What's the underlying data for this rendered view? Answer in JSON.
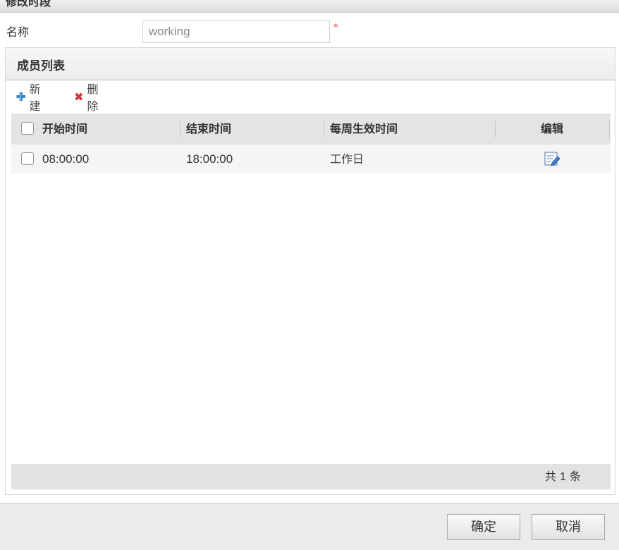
{
  "dialog": {
    "title": "修改时段"
  },
  "form": {
    "name_label": "名称",
    "name_value": "working",
    "required_mark": "*"
  },
  "panel": {
    "title": "成员列表",
    "toolbar": {
      "new_label": "新建",
      "new_icon": "plus-icon",
      "delete_label": "删除",
      "delete_icon": "delete-x-icon"
    },
    "grid": {
      "columns": [
        "开始时间",
        "结束时间",
        "每周生效时间",
        "编辑"
      ],
      "rows": [
        {
          "start": "08:00:00",
          "end": "18:00:00",
          "weekly": "工作日",
          "edit_icon": "edit-icon",
          "checked": false
        }
      ],
      "footer": {
        "prefix": "共",
        "count": "1",
        "suffix": "条"
      }
    }
  },
  "buttons": {
    "confirm": "确定",
    "cancel": "取消"
  },
  "colors": {
    "plus": "#3a84c9",
    "delete": "#d9393b",
    "required": "#e33333"
  }
}
